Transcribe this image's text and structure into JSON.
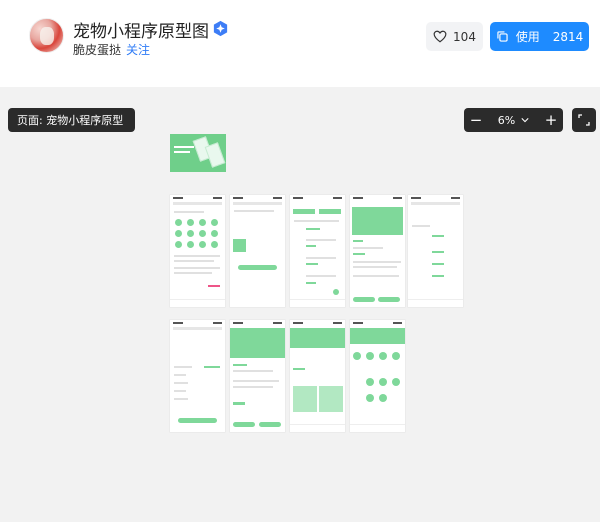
{
  "header": {
    "title": "宠物小程序原型图",
    "author": "脆皮蛋挞",
    "follow_label": "关注",
    "like_count": "104",
    "use_label": "使用",
    "use_count": "2814"
  },
  "toolbar": {
    "page_label": "页面: 宠物小程序原型",
    "zoom_minus": "−",
    "zoom_value": "6%",
    "zoom_plus": "+"
  },
  "colors": {
    "accent": "#1e8bff",
    "prototype_green": "#7fd89a",
    "toolbar_dark": "#2b2b2b",
    "follow_link": "#2f7cf6"
  },
  "icons": [
    "verified-badge-icon",
    "heart-icon",
    "copy-icon",
    "chevron-down-icon",
    "fullscreen-icon"
  ]
}
